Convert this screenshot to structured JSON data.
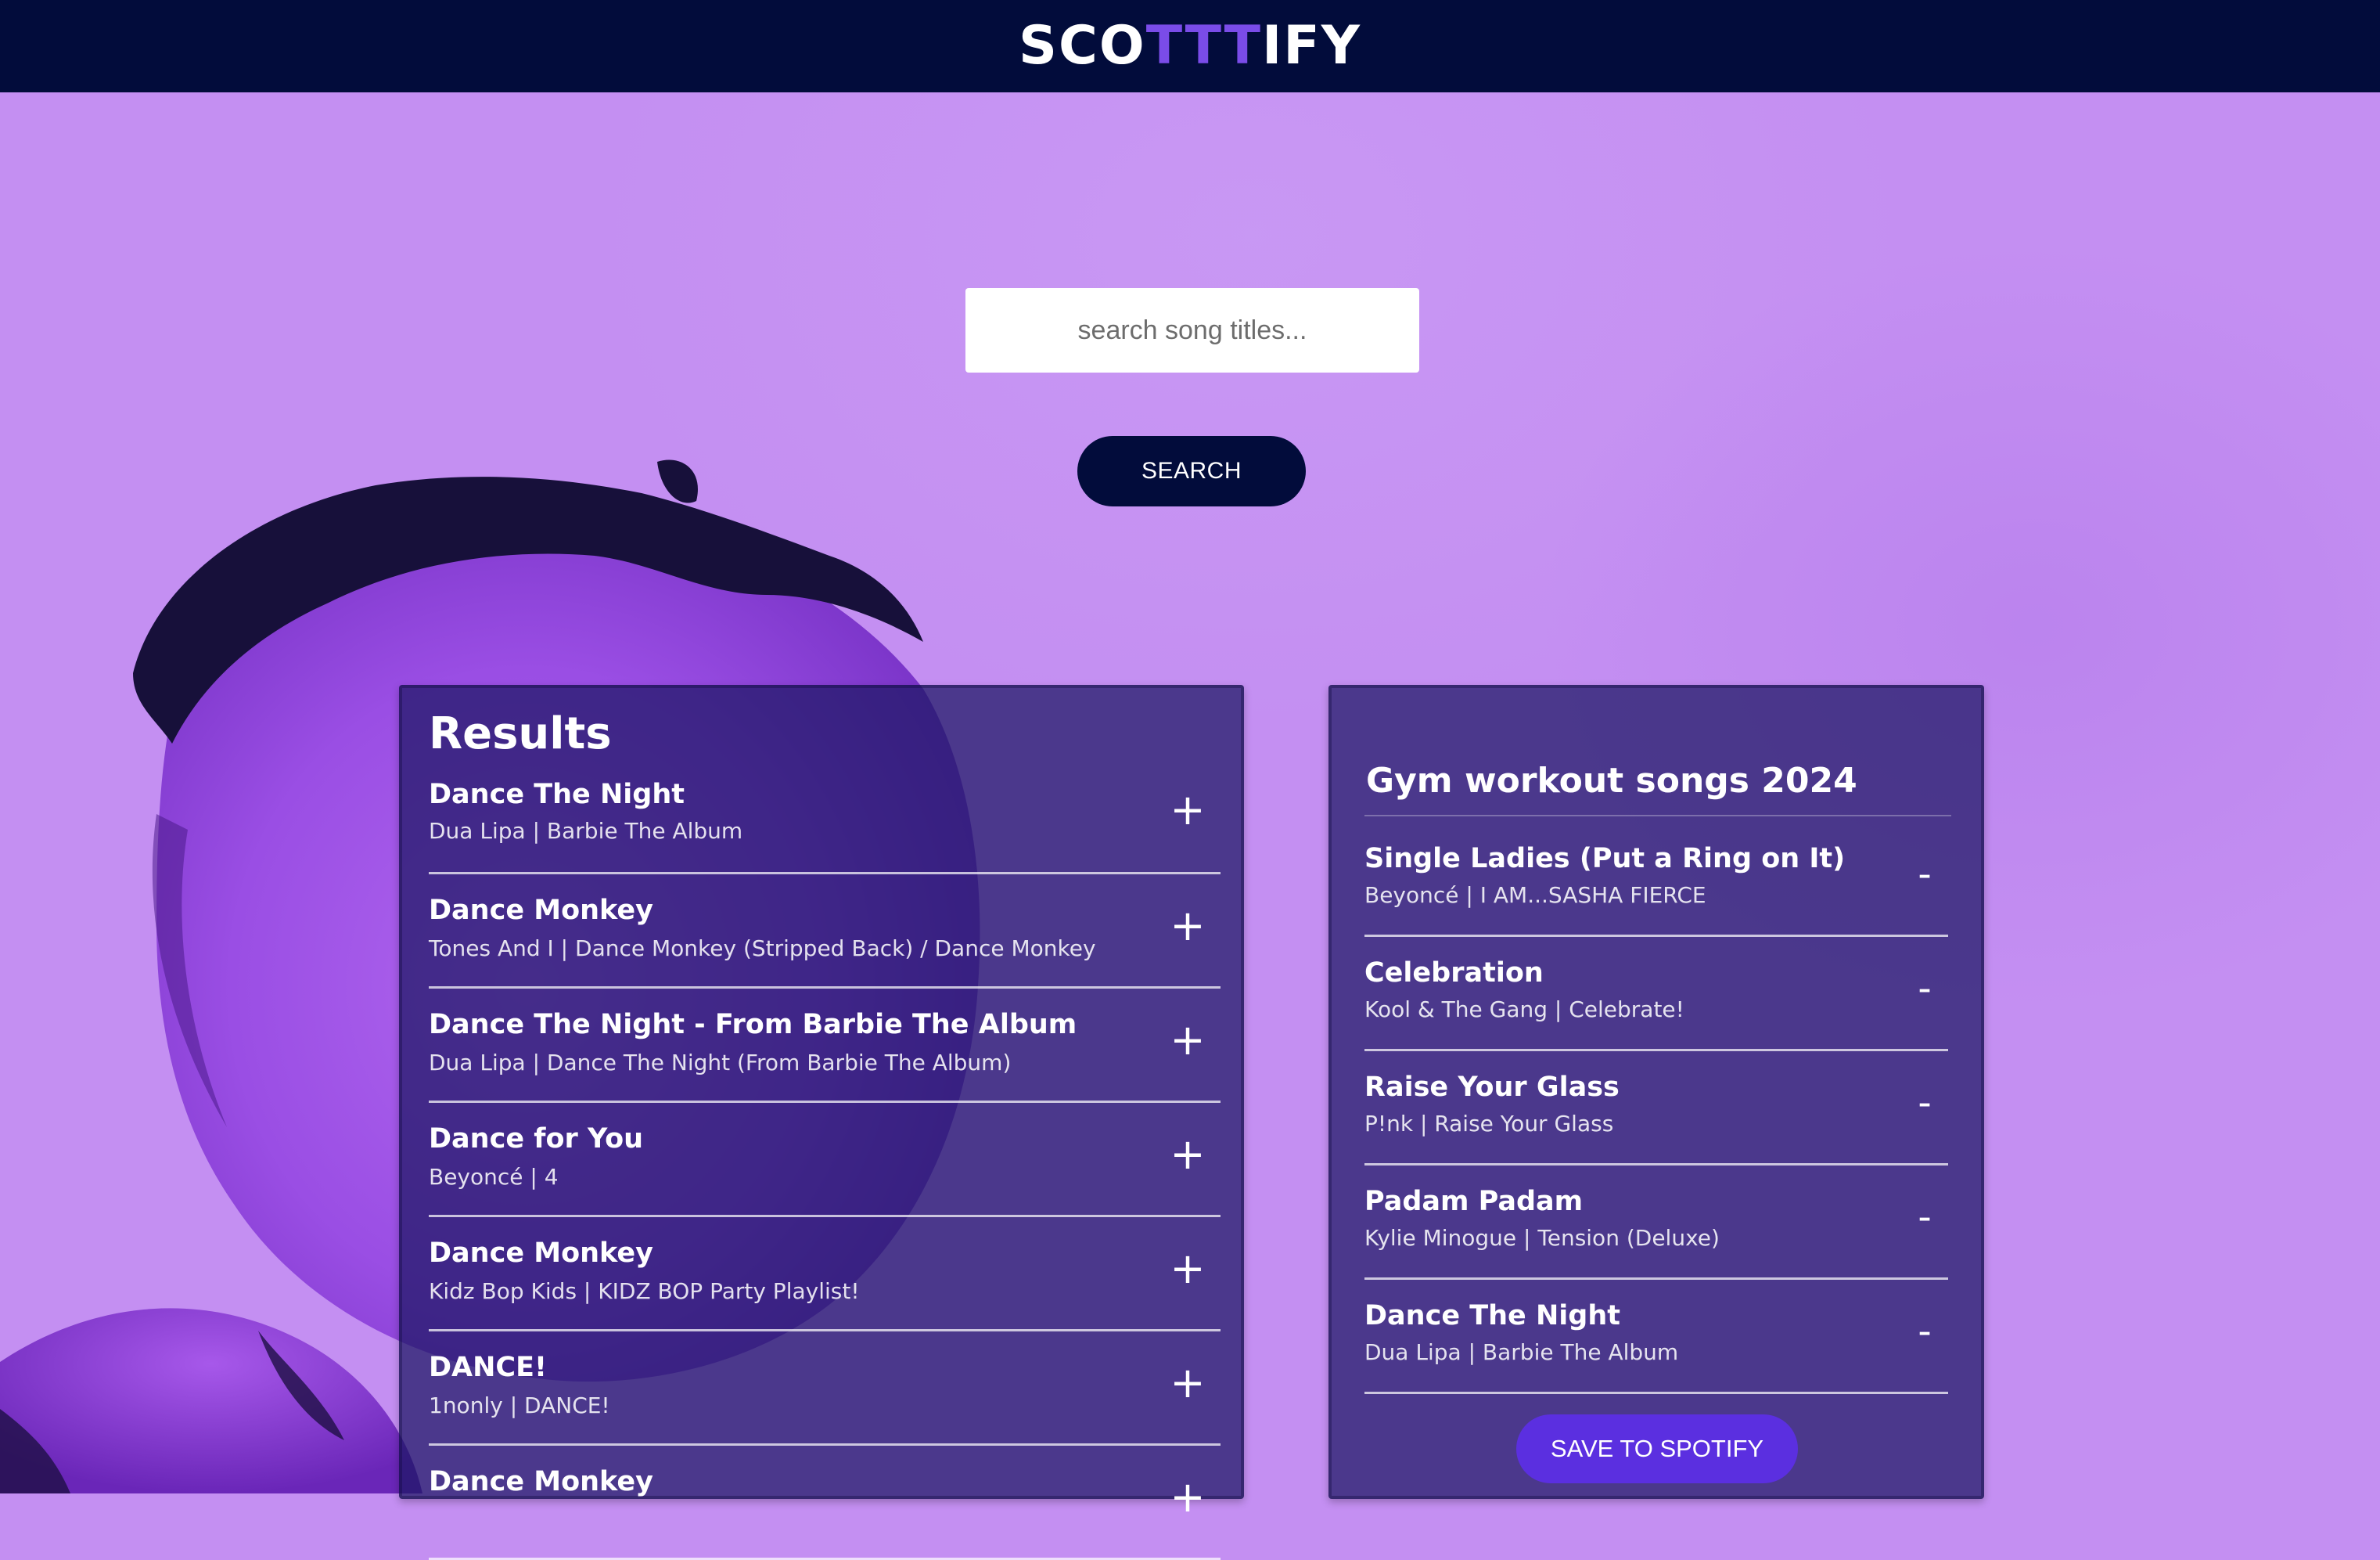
{
  "header": {
    "logo_prefix": "SCO",
    "logo_accent": "TTT",
    "logo_suffix": "IFY"
  },
  "colors": {
    "header_bg": "#020c3b",
    "page_bg": "#c48ff2",
    "logo_accent": "#7a4ce8",
    "save_button": "#5b2fe0"
  },
  "search": {
    "placeholder": "search song titles...",
    "button_label": "SEARCH"
  },
  "results": {
    "title": "Results",
    "add_icon": "plus-icon",
    "tracks": [
      {
        "name": "Dance The Night",
        "meta": "Dua Lipa | Barbie The Album",
        "action": "+"
      },
      {
        "name": "Dance Monkey",
        "meta": "Tones And I | Dance Monkey (Stripped Back) / Dance Monkey",
        "action": "+"
      },
      {
        "name": "Dance The Night - From Barbie The Album",
        "meta": "Dua Lipa | Dance The Night (From Barbie The Album)",
        "action": "+"
      },
      {
        "name": "Dance for You",
        "meta": "Beyoncé | 4",
        "action": "+"
      },
      {
        "name": "Dance Monkey",
        "meta": "Kidz Bop Kids | KIDZ BOP Party Playlist!",
        "action": "+"
      },
      {
        "name": "DANCE!",
        "meta": "1nonly | DANCE!",
        "action": "+"
      },
      {
        "name": "Dance Monkey",
        "meta": "",
        "action": "+"
      }
    ]
  },
  "playlist": {
    "name": "Gym workout songs 2024",
    "remove_icon": "minus-icon",
    "tracks": [
      {
        "name": "Single Ladies (Put a Ring on It)",
        "meta": "Beyoncé | I AM...SASHA FIERCE",
        "action": "-"
      },
      {
        "name": "Celebration",
        "meta": "Kool & The Gang | Celebrate!",
        "action": "-"
      },
      {
        "name": "Raise Your Glass",
        "meta": "P!nk | Raise Your Glass",
        "action": "-"
      },
      {
        "name": "Padam Padam",
        "meta": "Kylie Minogue | Tension (Deluxe)",
        "action": "-"
      },
      {
        "name": "Dance The Night",
        "meta": "Dua Lipa | Barbie The Album",
        "action": "-"
      }
    ],
    "save_label": "SAVE TO SPOTIFY"
  }
}
